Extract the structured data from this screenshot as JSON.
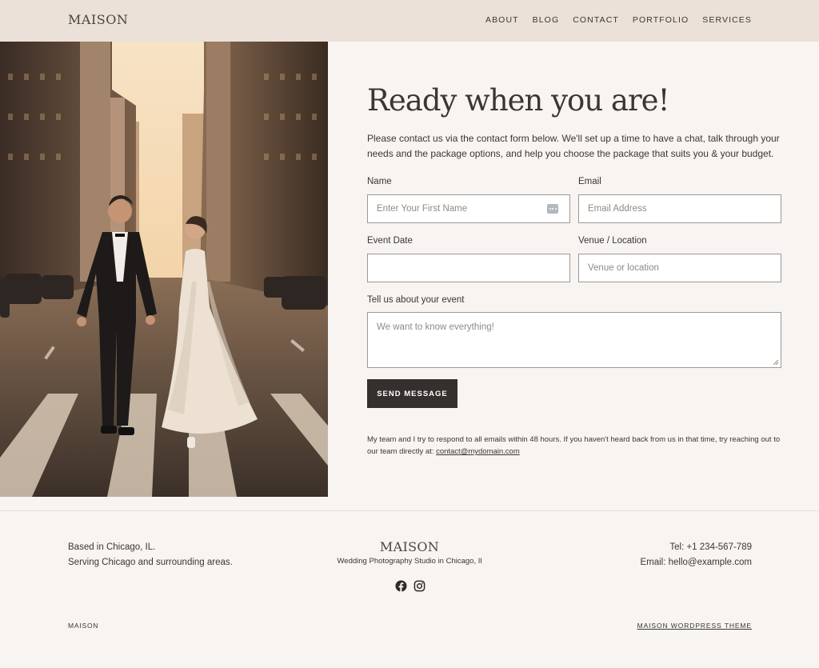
{
  "header": {
    "logo": "MAISON",
    "nav": [
      "ABOUT",
      "BLOG",
      "CONTACT",
      "PORTFOLIO",
      "SERVICES"
    ]
  },
  "hero_image": {
    "alt": "photo-of-couple-walking-city-street"
  },
  "contact": {
    "headline": "Ready when you are!",
    "intro": "Please contact us via the contact form below. We'll set up a time to have a chat, talk through your needs and the package options, and help you choose the package that suits you & your budget.",
    "name_label": "Name",
    "name_placeholder": "Enter Your First Name",
    "email_label": "Email",
    "email_placeholder": "Email Address",
    "date_label": "Event Date",
    "date_value": "",
    "venue_label": "Venue / Location",
    "venue_placeholder": "Venue or location",
    "message_label": "Tell us about your event",
    "message_placeholder": "We want to know everything!",
    "send_label": "SEND MESSAGE",
    "note_text": "My team and I try to respond to all emails within 48 hours. If you haven't heard back from us in that time, try reaching out to our team directly at: ",
    "note_email": "contact@mydomain.com"
  },
  "footer": {
    "location_line1": "Based in Chicago, IL.",
    "location_line2": "Serving Chicago and surrounding areas.",
    "brand": "MAISON",
    "tagline": "Wedding Photography Studio in Chicago, Il",
    "phone": "Tel: +1 234-567-789",
    "email": "Email: hello@example.com",
    "copyright": "MAISON",
    "theme_link": "MAISON WORDPRESS THEME"
  },
  "colors": {
    "header_bg": "#ebe1d8",
    "page_bg": "#f8f4f1",
    "button_bg": "#35302d",
    "text": "#3a3634"
  }
}
